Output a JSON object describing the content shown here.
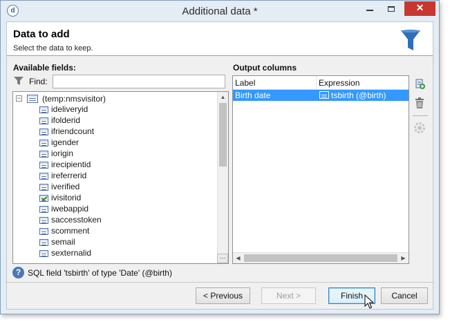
{
  "window": {
    "title": "Additional data *",
    "app_icon_glyph": "d",
    "controls": {
      "minimize": "minimize-icon",
      "maximize": "maximize-icon",
      "close": "✕"
    }
  },
  "header": {
    "title": "Data to add",
    "subtitle": "Select the data to keep.",
    "icon": "funnel-icon"
  },
  "available_fields": {
    "heading": "Available fields:",
    "find_label": "Find:",
    "find_value": "",
    "root": "(temp:nmsvisitor)",
    "root_expander": "−",
    "items": [
      {
        "label": "ideliveryid",
        "icon": "field-icon"
      },
      {
        "label": "ifolderid",
        "icon": "field-icon"
      },
      {
        "label": "ifriendcount",
        "icon": "field-icon"
      },
      {
        "label": "igender",
        "icon": "field-icon"
      },
      {
        "label": "iorigin",
        "icon": "field-icon"
      },
      {
        "label": "irecipientid",
        "icon": "field-icon"
      },
      {
        "label": "ireferrerid",
        "icon": "field-icon"
      },
      {
        "label": "iverified",
        "icon": "field-icon"
      },
      {
        "label": "ivisitorid",
        "icon": "key-field-icon"
      },
      {
        "label": "iwebappid",
        "icon": "field-icon"
      },
      {
        "label": "saccesstoken",
        "icon": "field-icon"
      },
      {
        "label": "scomment",
        "icon": "field-icon"
      },
      {
        "label": "semail",
        "icon": "field-icon"
      },
      {
        "label": "sexternalid",
        "icon": "field-icon"
      }
    ],
    "corner_button": "⋯"
  },
  "output_columns": {
    "heading": "Output columns",
    "columns": [
      "Label",
      "Expression"
    ],
    "rows": [
      {
        "label": "Birth date",
        "expression": "tsbirth (@birth)",
        "selected": true
      }
    ]
  },
  "side_toolbar": {
    "add": "add-column-icon",
    "delete": "trash-icon",
    "advanced": "gear-icon"
  },
  "status": {
    "icon": "help-icon",
    "icon_glyph": "?",
    "text": "SQL field 'tsbirth' of type 'Date' (@birth)"
  },
  "buttons": {
    "previous": "< Previous",
    "next": "Next >",
    "finish": "Finish",
    "cancel": "Cancel"
  },
  "colors": {
    "selection": "#3399ff",
    "close_button": "#c7372f",
    "funnel": "#2f6fb9"
  }
}
